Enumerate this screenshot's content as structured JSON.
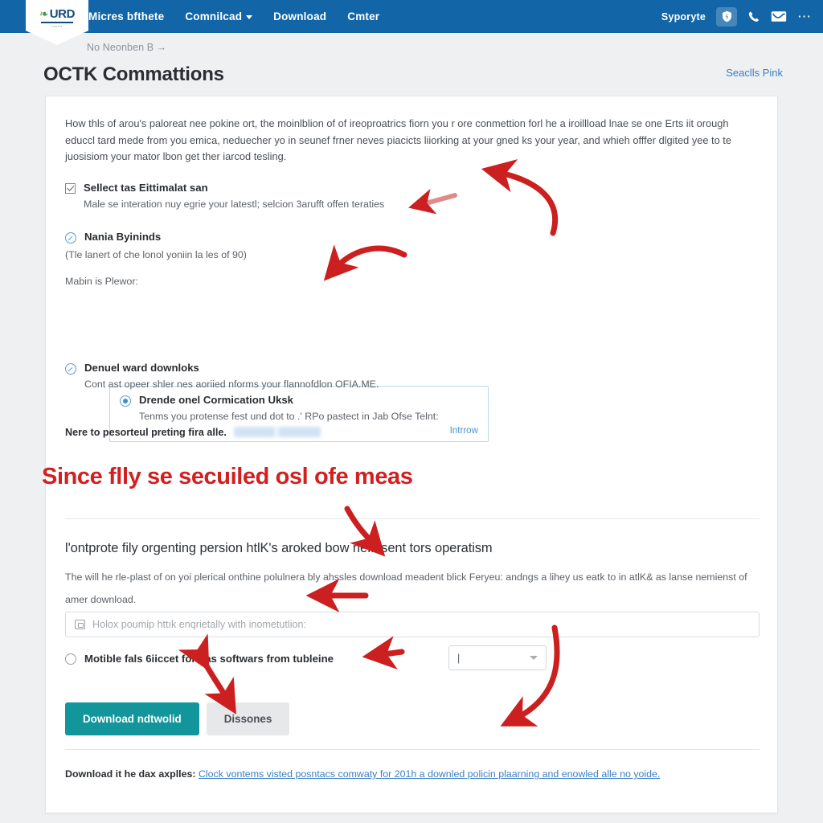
{
  "nav": {
    "logo": {
      "word": "URD",
      "sub": "centre",
      "leaf_icon": "leaf-icon"
    },
    "links": [
      {
        "label": "Micres bfthete",
        "has_caret": false
      },
      {
        "label": "Comnilcad",
        "has_caret": true
      },
      {
        "label": "Download",
        "has_caret": false
      },
      {
        "label": "Cmter",
        "has_caret": false
      }
    ],
    "user_label": "Syporyte",
    "icons": [
      "shield-lock-icon",
      "phone-icon",
      "envelope-icon",
      "more-options-icon"
    ],
    "bar_color": "#1266a8"
  },
  "breadcrumb": {
    "text": "No Neonben B →"
  },
  "header": {
    "title": "OCTK Commattions",
    "right_link": "Seaclls Pink"
  },
  "card": {
    "intro": "How thls of arou's paloreat nee pokine ort, the moinlblion of of ireoproatrics fiorn you r ore conmettion forl he a iroillload lnae se one Erts iit orough educcl tard mede from you emica, neduecher yo in seunef frner neves piacicts liiorking at your gned ks your year, and whieh offfer dlgited yee to te juosisiom your mator lbon get ther iarcod tesling.",
    "options": [
      {
        "control": "checkbox-checked",
        "title": "Sellect tas Eittimalat san",
        "desc": "Male se interation nuy egrie your latestl; selcion 3arufft offen teraties"
      },
      {
        "control": "radio-slash",
        "title": "Nania Byininds",
        "desc": "(Tle lanert of che lonol yoniin la les of 90)"
      }
    ],
    "sub_label": "Mabin is Plewor:",
    "selected_option": {
      "control": "radio-selected",
      "title": "Drende onel Cormication Uksk",
      "desc": "Tenms you protense fest und dot to .' RPo pastect in Jab Ofse Telnt:",
      "link": "Intrrow",
      "border_color": "#b8d7ee"
    },
    "third_option": {
      "control": "radio-slash",
      "title": "Denuel ward downloks",
      "desc": "Cont ast opeer shler nes aoriied nforms your flannofdlon OFIA.ME."
    },
    "redacted_line": {
      "text": "Nere to pesorteul preting fira alle.",
      "redaction": "redacted-link"
    },
    "section": {
      "title": "l'ontprote fily orgenting persion htlK's aroked bow neflasent tors operatism",
      "desc": "The will he rle-plast of on yoi plerical onthine polulnera bly ahssles download meadent blick Feryeu: andngs a lihey us eatk to in atlK& as lanse nemienst of amer download.",
      "input_placeholder": "Holox­ poumip httık enqrietally with inometutlion:",
      "input_icon": "image-placeholder-icon",
      "input_value": "",
      "radio_label": "Motible fals 6iiccet forn as softwars from tubleine",
      "select_value": "",
      "select_caret": "chevron-down-icon",
      "primary_button": "Download ndtwolid",
      "secondary_button": "Dissones",
      "primary_color": "#12959b"
    },
    "footer": {
      "label": "Download it he dax axplles:",
      "link": "Clock vontems visted posntacs comwaty for 201h a downled policin plaarning and enowled alle no yoide."
    }
  },
  "annotation": {
    "headline": "Since flly se secuiled osl ofe meas",
    "color": "#d21f1f",
    "arrow_count": 7
  }
}
